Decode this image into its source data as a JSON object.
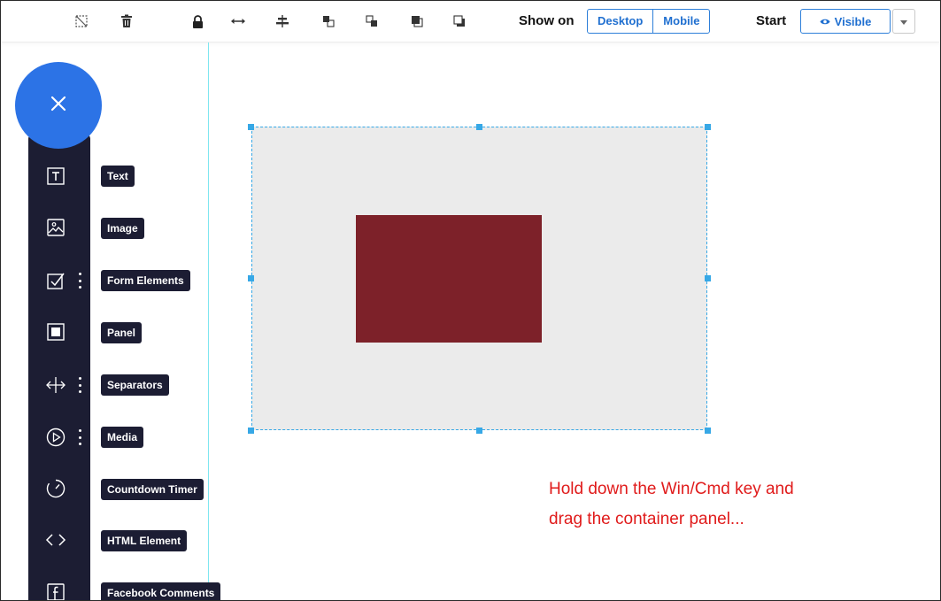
{
  "toolbar": {
    "icons": [
      {
        "name": "no-select-icon"
      },
      {
        "name": "trash-icon"
      },
      {
        "name": "lock-icon"
      },
      {
        "name": "stretch-width-icon"
      },
      {
        "name": "align-center-icon"
      },
      {
        "name": "bring-forward-icon"
      },
      {
        "name": "send-backward-icon"
      },
      {
        "name": "bring-to-front-icon"
      },
      {
        "name": "send-to-back-icon"
      }
    ],
    "show_on_label": "Show on",
    "show_on_options": [
      "Desktop",
      "Mobile"
    ],
    "start_label": "Start",
    "visibility_value": "Visible",
    "visibility_icon": "eye-icon",
    "dropdown_icon": "caret-down-icon"
  },
  "side_panel": {
    "close_icon": "close-icon",
    "items": [
      {
        "label": "Text",
        "icon": "text-icon",
        "has_more": false
      },
      {
        "label": "Image",
        "icon": "image-icon",
        "has_more": false
      },
      {
        "label": "Form Elements",
        "icon": "checkbox-icon",
        "has_more": true
      },
      {
        "label": "Panel",
        "icon": "panel-icon",
        "has_more": false
      },
      {
        "label": "Separators",
        "icon": "separator-icon",
        "has_more": true
      },
      {
        "label": "Media",
        "icon": "play-icon",
        "has_more": true
      },
      {
        "label": "Countdown Timer",
        "icon": "timer-icon",
        "has_more": false
      },
      {
        "label": "HTML Element",
        "icon": "code-icon",
        "has_more": false
      },
      {
        "label": "Facebook Comments",
        "icon": "facebook-icon",
        "has_more": false
      }
    ]
  },
  "annotation": {
    "line1": "Hold down the Win/Cmd key and",
    "line2": "drag the container panel..."
  },
  "colors": {
    "accent_blue": "#2c73e6",
    "panel_dark": "#1c1d33",
    "selection": "#37a8e6",
    "inner_element": "#7d2129",
    "container_bg": "#ebebeb",
    "note_red": "#e01b1b",
    "guide": "#7fe6f0"
  }
}
